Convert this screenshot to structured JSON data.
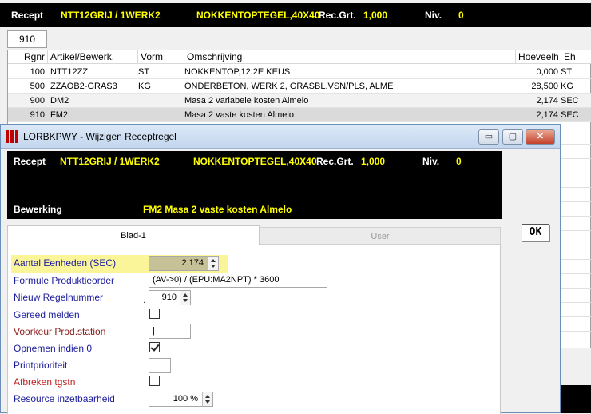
{
  "main": {
    "header": {
      "recept_label": "Recept",
      "recept_code": "NTT12GRIJ / 1WERK2",
      "description": "NOKKENTOPTEGEL,40X40",
      "recgrt_label": "Rec.Grt.",
      "recgrt_value": "1,000",
      "niv_label": "Niv.",
      "niv_value": "0"
    },
    "code_field": "910",
    "columns": [
      "Rgnr",
      "Artikel/Bewerk.",
      "Vorm",
      "Omschrijving",
      "Hoeveelh",
      "Eh"
    ],
    "rows": [
      {
        "rgnr": "100",
        "artikel": "NTT12ZZ",
        "vorm": "ST",
        "omschrijving": "NOKKENTOP,12,2E KEUS",
        "hoeveelh": "0,000",
        "eh": "ST"
      },
      {
        "rgnr": "500",
        "artikel": "ZZAOB2-GRAS3",
        "vorm": "KG",
        "omschrijving": "ONDERBETON, WERK 2, GRASBL.VSN/PLS, ALME",
        "hoeveelh": "28,500",
        "eh": "KG"
      },
      {
        "rgnr": "900",
        "artikel": "DM2",
        "vorm": "",
        "omschrijving": "Masa 2 variabele kosten Almelo",
        "hoeveelh": "2,174",
        "eh": "SEC"
      },
      {
        "rgnr": "910",
        "artikel": "FM2",
        "vorm": "",
        "omschrijving": "Masa 2 vaste kosten Almelo",
        "hoeveelh": "2,174",
        "eh": "SEC"
      }
    ]
  },
  "dialog": {
    "title": "LORBKPWY - Wijzigen Receptregel",
    "controls": {
      "minimize": "▭",
      "maximize": "▢",
      "close": "✕"
    },
    "header": {
      "recept_label": "Recept",
      "recept_code": "NTT12GRIJ / 1WERK2",
      "description": "NOKKENTOPTEGEL,40X40",
      "recgrt_label": "Rec.Grt.",
      "recgrt_value": "1,000",
      "niv_label": "Niv.",
      "niv_value": "0",
      "bewerking_label": "Bewerking",
      "bewerking_value": "FM2  Masa 2 vaste kosten Almelo"
    },
    "ok_label": "OK",
    "tabs": [
      "Blad-1",
      "User"
    ],
    "fields": {
      "aantal_label": "Aantal Eenheden (SEC)",
      "aantal_value": "2.174",
      "formule_label": "Formule Produktieorder",
      "formule_value": "(AV->0) / (EPU:MA2NPT) * 3600",
      "regelnummer_label": "Nieuw Regelnummer",
      "regelnummer_dots": "..",
      "regelnummer_value": "910",
      "gereed_label": "Gereed melden",
      "voorkeur_label": "Voorkeur Prod.station",
      "voorkeur_value": "|",
      "opnemen_label": "Opnemen indien 0",
      "print_label": "Printprioriteit",
      "print_value": "",
      "afbreken_label": "Afbreken tgstn",
      "resource_label": "Resource inzetbaarheid",
      "resource_value": "100 %"
    }
  }
}
